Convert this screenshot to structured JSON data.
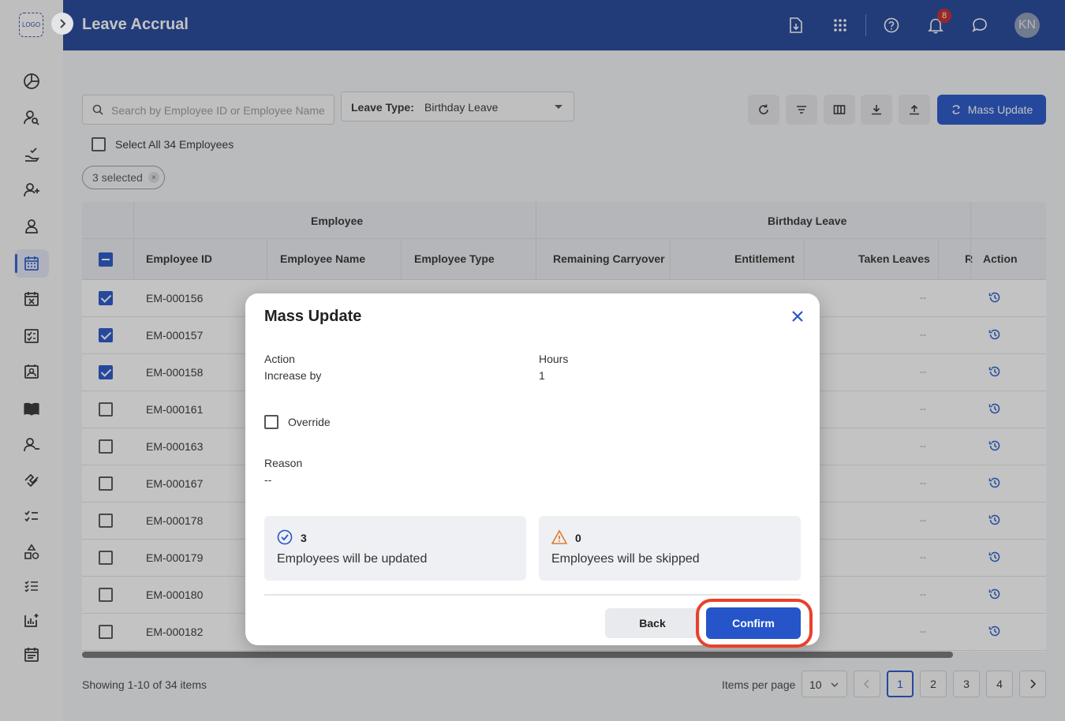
{
  "sidebar": {
    "logo": "LOGO",
    "icons": [
      "dashboard-icon",
      "employee-search-icon",
      "leave-approval-icon",
      "add-person-icon",
      "person-icon",
      "calendar-icon",
      "calendar-cancel-icon",
      "checklist-icon",
      "contact-card-icon",
      "book-icon",
      "remove-person-icon",
      "handshake-icon",
      "list-check-icon",
      "shapes-icon",
      "tasks-icon",
      "report-icon",
      "schedule-icon"
    ]
  },
  "header": {
    "title": "Leave Accrual",
    "notification_count": "8",
    "avatar_initials": "KN"
  },
  "search": {
    "placeholder": "Search by Employee ID or Employee Name"
  },
  "leave_type": {
    "label": "Leave Type:",
    "value": "Birthday Leave"
  },
  "toolbar": {
    "mass_update_label": "Mass Update"
  },
  "select_all_label": "Select All 34 Employees",
  "chip": {
    "label": "3 selected",
    "remove": "×"
  },
  "table": {
    "group_headers": [
      "Employee",
      "Birthday Leave"
    ],
    "columns": [
      "Employee ID",
      "Employee Name",
      "Employee Type",
      "Remaining Carryover",
      "Entitlement",
      "Taken Leaves",
      "R",
      "Action"
    ],
    "rows": [
      {
        "id": "EM-000156",
        "checked": true,
        "value": "--"
      },
      {
        "id": "EM-000157",
        "checked": true,
        "value": "--"
      },
      {
        "id": "EM-000158",
        "checked": true,
        "value": "--"
      },
      {
        "id": "EM-000161",
        "checked": false,
        "value": "--"
      },
      {
        "id": "EM-000163",
        "checked": false,
        "value": "--"
      },
      {
        "id": "EM-000167",
        "checked": false,
        "value": "--"
      },
      {
        "id": "EM-000178",
        "checked": false,
        "value": "--"
      },
      {
        "id": "EM-000179",
        "checked": false,
        "value": "--"
      },
      {
        "id": "EM-000180",
        "checked": false,
        "value": "--"
      },
      {
        "id": "EM-000182",
        "checked": false,
        "value": "--"
      }
    ]
  },
  "footer": {
    "showing": "Showing 1-10 of 34 items",
    "items_per_page_label": "Items per page",
    "items_per_page": "10",
    "pages": [
      "1",
      "2",
      "3",
      "4"
    ],
    "current_page": "1"
  },
  "modal": {
    "title": "Mass Update",
    "action_label": "Action",
    "action_value": "Increase by",
    "hours_label": "Hours",
    "hours_value": "1",
    "override_label": "Override",
    "reason_label": "Reason",
    "reason_value": "--",
    "updated_count": "3",
    "updated_text": "Employees will be updated",
    "skipped_count": "0",
    "skipped_text": "Employees will be skipped",
    "back_label": "Back",
    "confirm_label": "Confirm"
  },
  "colors": {
    "header": "#21449a",
    "primary": "#2555c9",
    "highlight": "#e8412b",
    "warning": "#e07a2e"
  }
}
